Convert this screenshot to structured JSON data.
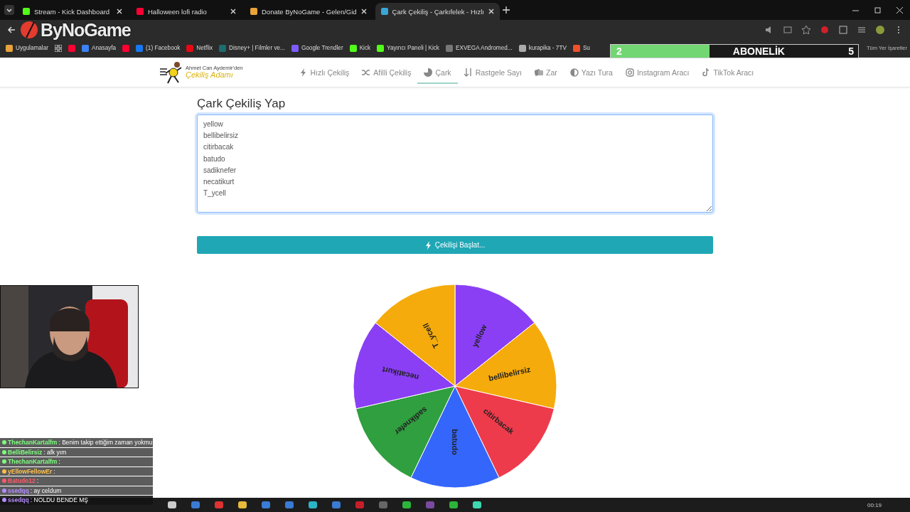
{
  "browser": {
    "tabs": [
      {
        "title": "Stream - Kick Dashboard",
        "selected": false
      },
      {
        "title": "Halloween lofi radio",
        "selected": false
      },
      {
        "title": "Donate ByNoGame - Gelen/Gid",
        "selected": false
      },
      {
        "title": "Çark Çekiliş - Çarkıfelek - Hızlı",
        "selected": true
      }
    ],
    "bookmarks": [
      {
        "kind": "link",
        "label": "Uygulamalar"
      },
      {
        "kind": "icon"
      },
      {
        "kind": "link",
        "label": "Anasayfa"
      },
      {
        "kind": "icon"
      },
      {
        "kind": "link",
        "label": "(1) Facebook"
      },
      {
        "kind": "link",
        "label": "Netflix"
      },
      {
        "kind": "link",
        "label": "Disney+ | Filmler ve..."
      },
      {
        "kind": "link",
        "label": "Google Trendler"
      },
      {
        "kind": "link",
        "label": "Kick"
      },
      {
        "kind": "link",
        "label": "Yayıncı Paneli | Kick"
      },
      {
        "kind": "link",
        "label": "EXVEGA Andromed..."
      },
      {
        "kind": "link",
        "label": "kurapika - 7TV"
      },
      {
        "kind": "link",
        "label": "Su"
      }
    ],
    "all_bookmarks": "Tüm Yer İşaretler"
  },
  "stream_logo": "ByNoGame",
  "sub_goal": {
    "current": "2",
    "label": "ABONELİK",
    "target": "5",
    "level": 0.4
  },
  "site": {
    "logo_tagline": "Ahmet Can Aydemir'den",
    "logo_name": "Çekiliş Adamı",
    "nav": [
      {
        "label": "Hızlı Çekiliş",
        "selected": false
      },
      {
        "label": "Afilli Çekiliş",
        "selected": false
      },
      {
        "label": "Çark",
        "selected": true
      },
      {
        "label": "Rastgele Sayı",
        "selected": false
      },
      {
        "label": "Zar",
        "selected": false
      },
      {
        "label": "Yazı Tura",
        "selected": false
      },
      {
        "label": "Instagram Aracı",
        "selected": false
      },
      {
        "label": "TikTok Aracı",
        "selected": false
      }
    ],
    "heading": "Çark Çekiliş Yap",
    "entries": [
      "yellow",
      "bellibelirsiz",
      "citirbacak",
      "batudo",
      "sadiknefer",
      "necatikurt",
      "T_ycell"
    ],
    "start_button": "Çekilişi Başlat...",
    "wheel": [
      {
        "label": "yellow",
        "color": "#8a3ff5"
      },
      {
        "label": "bellibelirsiz",
        "color": "#f5ab0b"
      },
      {
        "label": "citirbacak",
        "color": "#ee3b4b"
      },
      {
        "label": "batudo",
        "color": "#3566fb"
      },
      {
        "label": "sadiknefer",
        "color": "#2f9f3f"
      },
      {
        "label": "necatikurt",
        "color": "#8a3ff5"
      },
      {
        "label": "T_ycell",
        "color": "#f5ab0b"
      }
    ]
  },
  "chat": [
    {
      "user": "ThechanKartalfm",
      "text": ": Benim takip ettiğim zaman yokmu",
      "color": "#7dff7d"
    },
    {
      "user": "BelliBelirsiz",
      "text": ": afk yım",
      "color": "#7dff7d"
    },
    {
      "user": "ThechanKartalfm",
      "text": ":",
      "color": "#7dff7d"
    },
    {
      "user": "yEllowFellowEr",
      "text": ":",
      "color": "#ffc04a"
    },
    {
      "user": "Batudo12",
      "text": ":",
      "color": "#ff5a6a"
    },
    {
      "user": "ssedqq",
      "text": ": ay celdum",
      "color": "#b48cff"
    },
    {
      "user": "ssedqq",
      "text": ": NOLDU BENDE MŞ",
      "color": "#b48cff"
    }
  ],
  "taskbar": {
    "clock": "00:19"
  }
}
